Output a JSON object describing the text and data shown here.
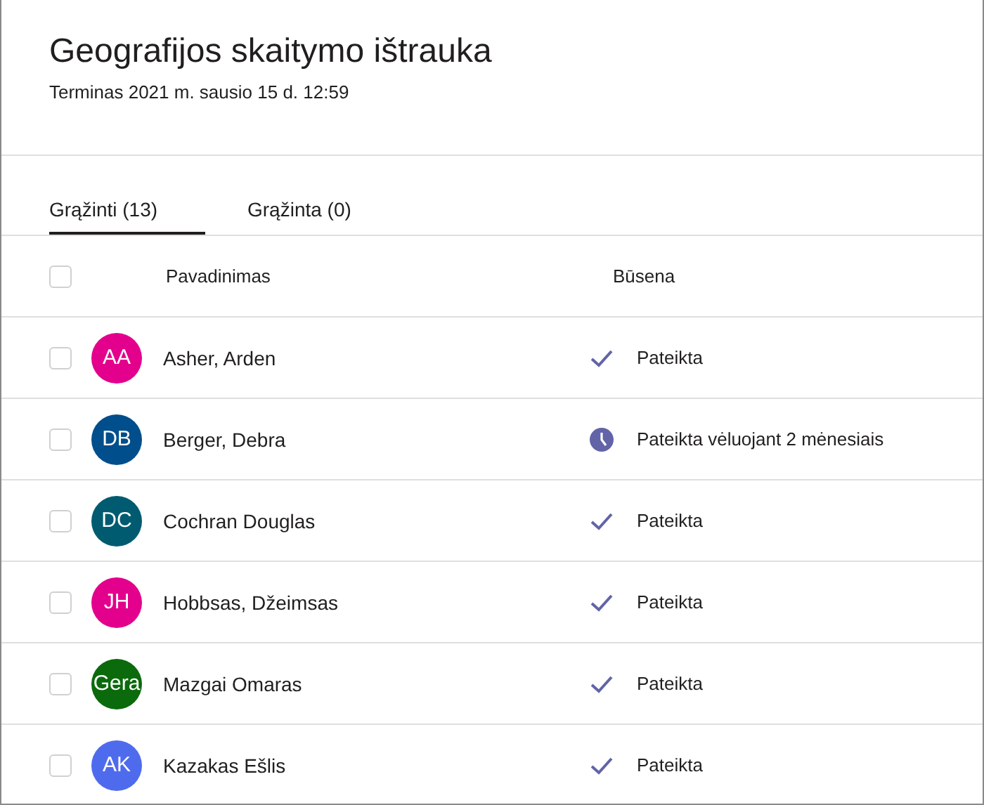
{
  "header": {
    "title": "Geografijos skaitymo ištrauka",
    "due": "Terminas 2021 m. sausio 15 d. 12:59"
  },
  "tabs": [
    {
      "label": "Grąžinti (13)",
      "selected": true
    },
    {
      "label": "Grąžinta (0)",
      "selected": false
    }
  ],
  "table": {
    "select_all": {
      "checked": false
    },
    "columns": [
      "Pavadinimas",
      "Būsena"
    ],
    "rows": [
      {
        "checked": false,
        "initials": "AA",
        "color": "#e3008c",
        "name": "Asher, Arden",
        "status": {
          "kind": "submitted",
          "text": "Pateikta"
        }
      },
      {
        "checked": false,
        "initials": "DB",
        "color": "#004e8c",
        "name": "Berger, Debra",
        "status": {
          "kind": "late",
          "text": "Pateikta vėluojant 2 mėnesiais"
        }
      },
      {
        "checked": false,
        "initials": "DC",
        "color": "#005b70",
        "name": "Cochran Douglas",
        "status": {
          "kind": "submitted",
          "text": "Pateikta"
        }
      },
      {
        "checked": false,
        "initials": "JH",
        "color": "#e3008c",
        "name": "Hobbsas, Džeimsas",
        "status": {
          "kind": "submitted",
          "text": "Pateikta"
        }
      },
      {
        "checked": false,
        "initials": "Gera",
        "color": "#0b6a0b",
        "name": "Mazgai Omaras",
        "status": {
          "kind": "submitted",
          "text": "Pateikta"
        }
      },
      {
        "checked": false,
        "initials": "AK",
        "color": "#4f6bed",
        "name": "Kazakas Ešlis",
        "status": {
          "kind": "submitted",
          "text": "Pateikta"
        }
      }
    ]
  }
}
